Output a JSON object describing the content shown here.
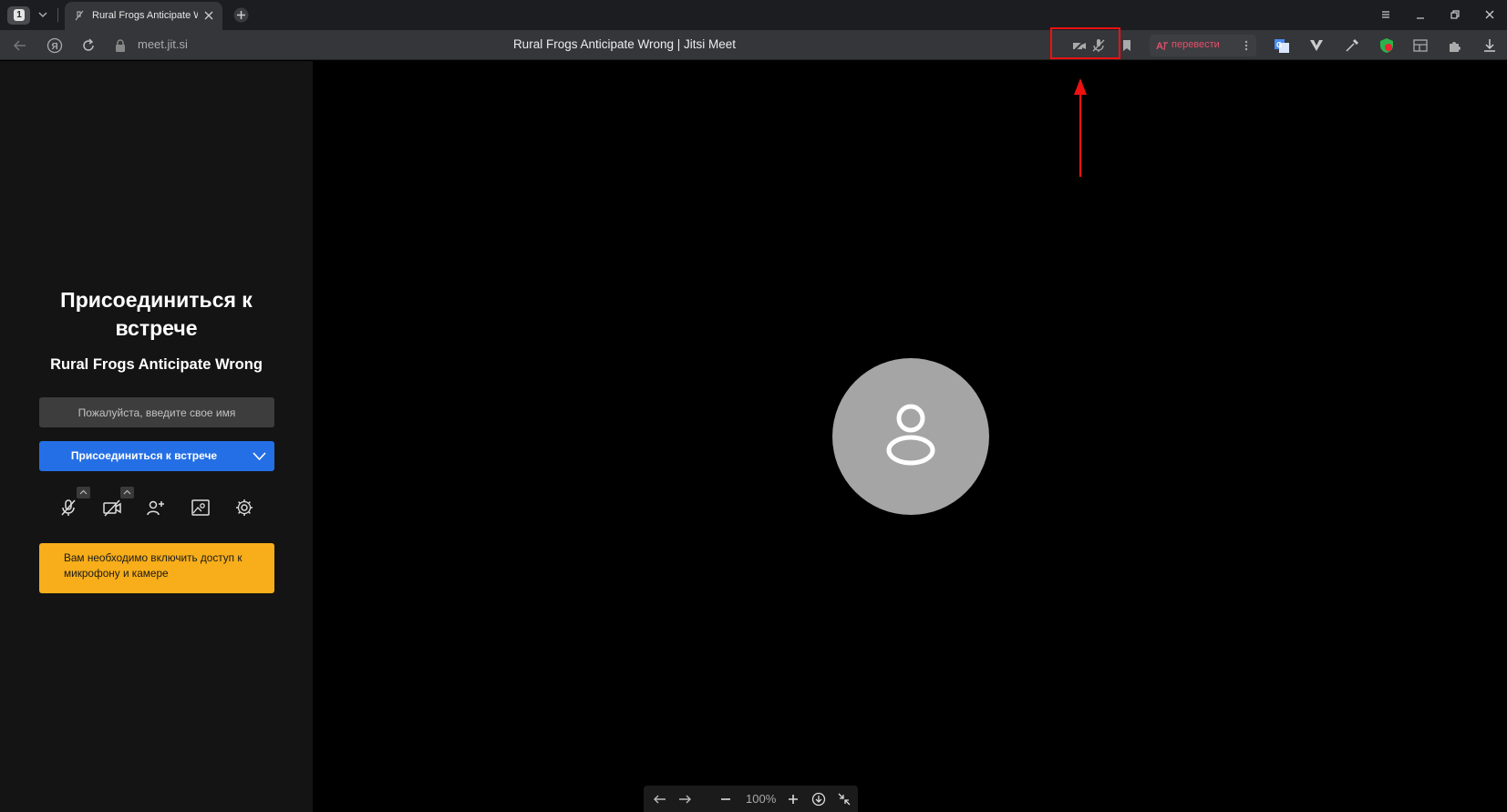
{
  "browser": {
    "tab_counter": "1",
    "tab_title": "Rural Frogs Anticipate Wrong | Jitsi Meet",
    "address_host": "meet.jit.si",
    "page_title": "Rural Frogs Anticipate Wrong | Jitsi Meet",
    "translate_label": "перевести"
  },
  "prejoin": {
    "heading": "Присоединиться к встрече",
    "room_name": "Rural Frogs Anticipate Wrong",
    "name_placeholder": "Пожалуйста, введите свое имя",
    "join_button": "Присоединиться к встрече",
    "warning": "Вам необходимо включить доступ к микрофону и камере"
  },
  "bottom_bar": {
    "zoom": "100%"
  },
  "colors": {
    "accent": "#246fe5",
    "warning": "#f8ae1a",
    "annotation": "#e11"
  }
}
